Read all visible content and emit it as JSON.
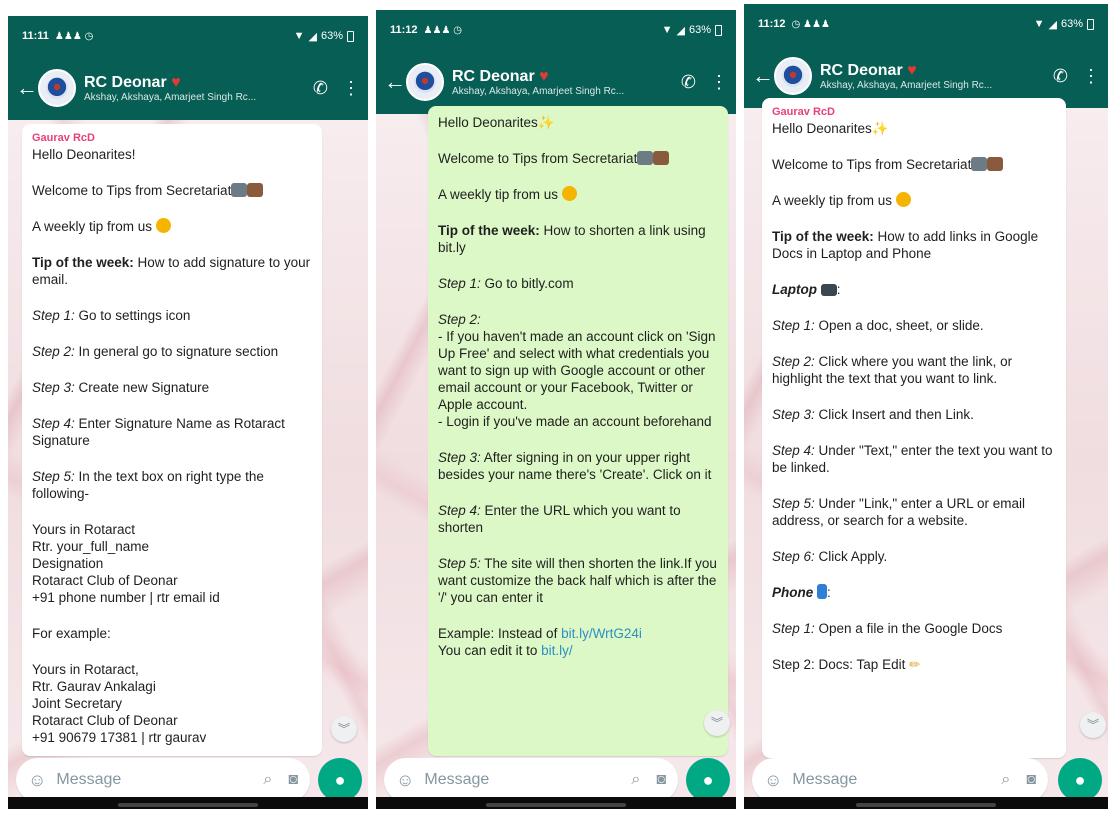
{
  "group": {
    "name": "RC Deonar",
    "members": "Akshay, Akshaya, Amarjeet Singh Rc..."
  },
  "colors": {
    "header": "#075e54",
    "incoming": "#ffffff",
    "outgoing": "#dcf8c6",
    "sender": "#e8407a",
    "link": "#2d8fc3",
    "mic": "#00a884"
  },
  "input_placeholder": "Message",
  "phones": [
    {
      "time": "11:11",
      "battery": "63%",
      "sender": "Gaurav RcD",
      "lines": [
        "Hello Deonarites!",
        "",
        "Welcome to Tips from Secretariat",
        "",
        "A weekly tip from us",
        "",
        "Tip of the week: How to add signature to your email.",
        "",
        "Step 1: Go to settings icon",
        "",
        "Step 2: In general go to signature section",
        "",
        "Step 3: Create new Signature",
        "",
        "Step 4: Enter Signature Name as Rotaract Signature",
        "",
        "Step 5: In the text box on right type the following-",
        "",
        "Yours in Rotaract",
        "Rtr. your_full_name",
        "Designation",
        "Rotaract Club of Deonar",
        "+91 phone number | rtr email id",
        "",
        "For example:",
        "",
        "Yours in Rotaract,",
        "Rtr. Gaurav Ankalagi",
        "Joint Secretary",
        "Rotaract Club of Deonar",
        "+91 90679 17381 | rtr gaurav"
      ]
    },
    {
      "time": "11:12",
      "battery": "63%",
      "lines": [
        "Hello Deonarites",
        "",
        "Welcome to Tips from Secretariat",
        "",
        "A weekly tip from us",
        "",
        "Tip of the week: How to shorten a link using bit.ly",
        "",
        "Step 1: Go to bitly.com",
        "",
        "Step 2:",
        "- If you haven't made an account click on 'Sign Up Free' and select with what credentials you want to sign up with Google account or other email account or your Facebook, Twitter or Apple account.",
        "- Login if you've made an account beforehand",
        "",
        "Step 3: After signing in on your upper right besides your name there's 'Create'. Click on it",
        "",
        "Step 4: Enter the URL which you want to shorten",
        "",
        "Step 5: The site will then shorten the link.If you want customize the back half which is after the '/' you can enter it",
        "",
        "Example: Instead of bit.ly/WrtG24i",
        "You can edit it to bit.ly/"
      ]
    },
    {
      "time": "11:12",
      "battery": "63%",
      "sender": "Gaurav RcD",
      "lines": [
        "Hello Deonarites",
        "",
        "Welcome to Tips from Secretariat",
        "",
        "A weekly tip from us",
        "",
        "Tip of the week: How to add links in Google Docs in Laptop and Phone",
        "",
        "Laptop",
        "",
        "Step 1: Open a doc, sheet, or slide.",
        "",
        "Step 2: Click where you want the link, or highlight the text that you want to link.",
        "",
        "Step 3: Click Insert and then Link.",
        "",
        "Step 4: Under \"Text,\" enter the text you want to be linked.",
        "",
        "Step 5: Under \"Link,\" enter a URL or email address, or search for a website.",
        "",
        "Step 6: Click Apply.",
        "",
        "Phone",
        "",
        "Step 1: Open a file in the Google Docs",
        "",
        "Step 2: Docs: Tap Edit"
      ]
    }
  ]
}
